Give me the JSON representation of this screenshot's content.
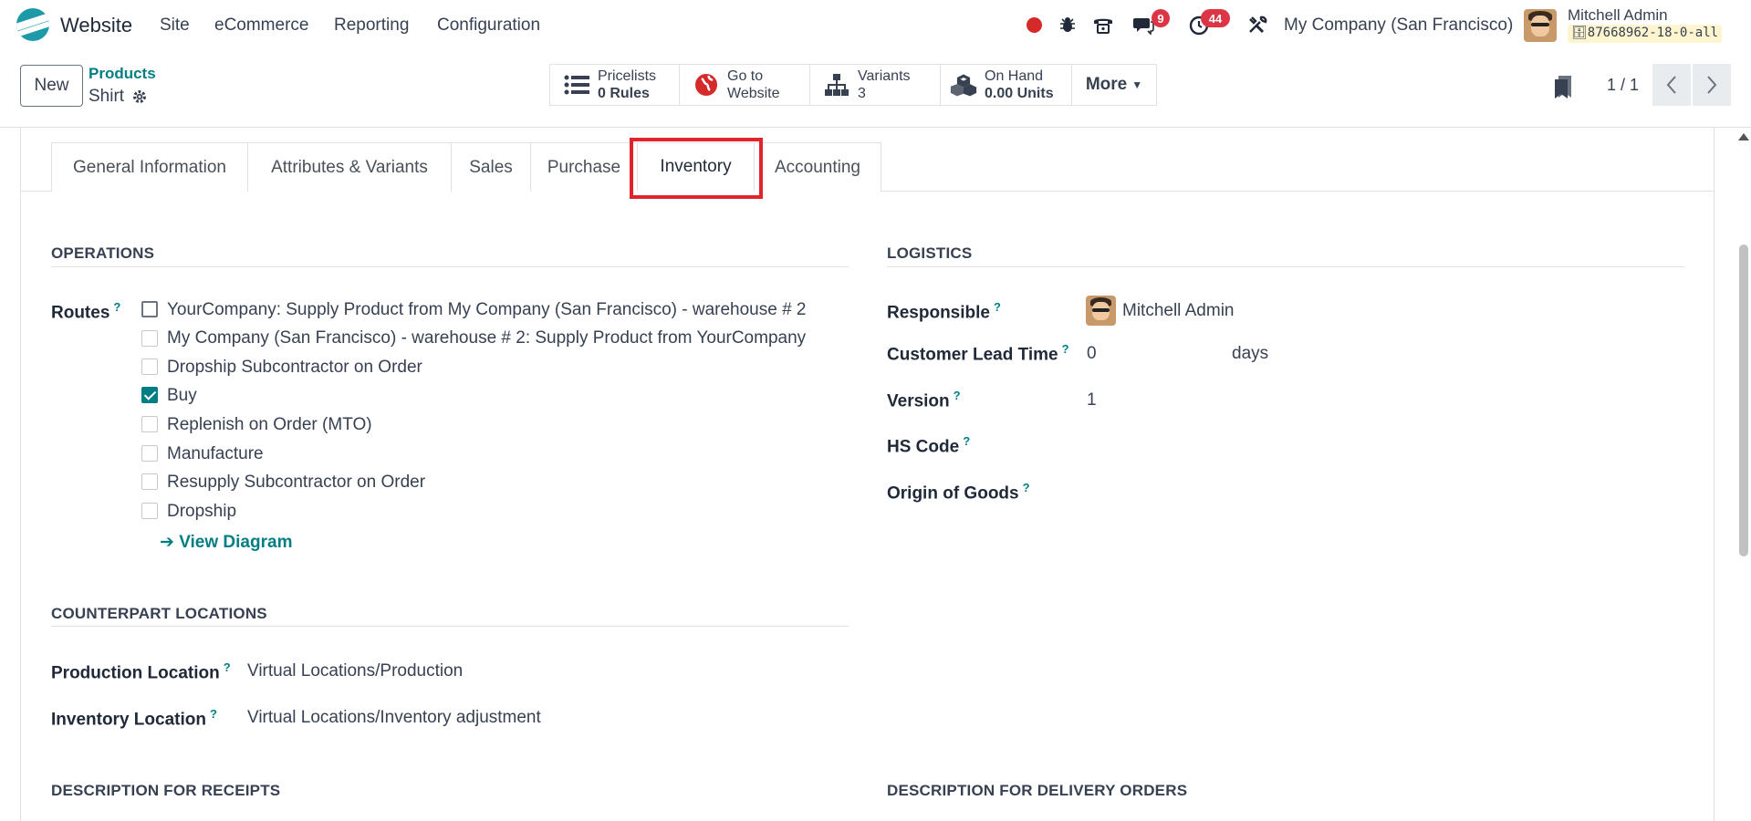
{
  "topbar": {
    "app_name": "Website",
    "menu": [
      "Site",
      "eCommerce",
      "Reporting",
      "Configuration"
    ],
    "messages_count": "9",
    "activities_count": "44",
    "company": "My Company (San Francisco)",
    "user_name": "Mitchell Admin",
    "db_name": "87668962-18-0-all"
  },
  "control_panel": {
    "new_label": "New",
    "breadcrumb_parent": "Products",
    "breadcrumb_current": "Shirt",
    "smart_buttons": [
      {
        "line1": "Pricelists",
        "line2": "0 Rules",
        "icon": "list-icon"
      },
      {
        "line1": "Go to",
        "line2": "Website",
        "icon": "globe-icon"
      },
      {
        "line1": "Variants",
        "line2": "3",
        "icon": "sitemap-icon"
      },
      {
        "line1": "On Hand",
        "line2": "0.00 Units",
        "icon": "cubes-icon"
      }
    ],
    "more_label": "More",
    "pager": "1 / 1"
  },
  "tabs": [
    "General Information",
    "Attributes & Variants",
    "Sales",
    "Purchase",
    "Inventory",
    "Accounting"
  ],
  "active_tab": "Inventory",
  "operations": {
    "heading": "OPERATIONS",
    "routes_label": "Routes",
    "routes": [
      {
        "label": "YourCompany: Supply Product from My Company (San Francisco) - warehouse # 2",
        "checked": false
      },
      {
        "label": "My Company (San Francisco) - warehouse # 2: Supply Product from YourCompany",
        "checked": false
      },
      {
        "label": "Dropship Subcontractor on Order",
        "checked": false
      },
      {
        "label": "Buy",
        "checked": true
      },
      {
        "label": "Replenish on Order (MTO)",
        "checked": false
      },
      {
        "label": "Manufacture",
        "checked": false
      },
      {
        "label": "Resupply Subcontractor on Order",
        "checked": false
      },
      {
        "label": "Dropship",
        "checked": false
      }
    ],
    "view_diagram": "View Diagram"
  },
  "logistics": {
    "heading": "LOGISTICS",
    "responsible_label": "Responsible",
    "responsible_value": "Mitchell Admin",
    "lead_time_label": "Customer Lead Time",
    "lead_time_value": "0",
    "lead_time_unit": "days",
    "version_label": "Version",
    "version_value": "1",
    "hs_code_label": "HS Code",
    "origin_label": "Origin of Goods"
  },
  "counterpart": {
    "heading": "COUNTERPART LOCATIONS",
    "production_label": "Production Location",
    "production_value": "Virtual Locations/Production",
    "inventory_label": "Inventory Location",
    "inventory_value": "Virtual Locations/Inventory adjustment"
  },
  "descriptions": {
    "receipts_heading": "DESCRIPTION FOR RECEIPTS",
    "delivery_heading": "DESCRIPTION FOR DELIVERY ORDERS"
  },
  "colors": {
    "accent": "#017e84",
    "brand": "#1d9aa8",
    "highlight": "#e0242b",
    "badge": "#dc3545"
  }
}
